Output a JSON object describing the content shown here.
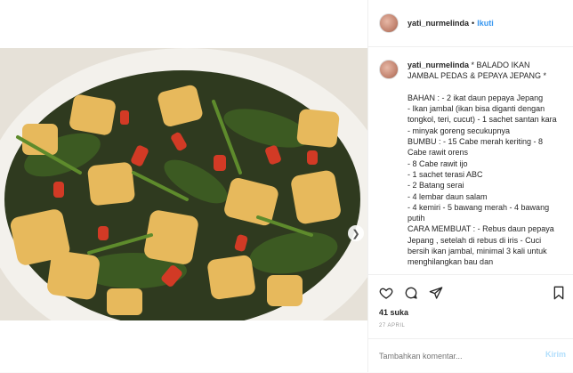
{
  "header": {
    "username": "yati_nurmelinda",
    "separator": "•",
    "follow_label": "Ikuti"
  },
  "caption": {
    "username": "yati_nurmelinda",
    "text": " * BALADO IKAN JAMBAL PEDAS & PEPAYA JEPANG *\n\nBAHAN : - 2 ikat daun pepaya Jepang\n- Ikan jambal (ikan bisa diganti dengan tongkol, teri, cucut) - 1 sachet santan kara\n- minyak goreng secukupnya\nBUMBU : - 15 Cabe merah keriting - 8 Cabe rawit orens\n- 8 Cabe rawit ijo\n- 1 sachet terasi ABC\n- 2 Batang serai\n- 4 lembar daun salam\n- 4 kemiri - 5 bawang merah - 4 bawang putih\nCARA MEMBUAT : - Rebus daun pepaya Jepang , setelah di rebus di iris - Cuci bersih ikan jambal, minimal 3 kali untuk menghilangkan bau dan"
  },
  "actions": {
    "likes": "41 suka",
    "date": "27 APRIL"
  },
  "comment": {
    "placeholder": "Tambahkan komentar...",
    "post_label": "Kirim"
  },
  "icons": {
    "like": "heart-icon",
    "comment": "comment-icon",
    "share": "share-icon",
    "save": "bookmark-icon",
    "next": "chevron-right-icon"
  },
  "colors": {
    "follow": "#3897f0",
    "post_disabled": "#b2dffc"
  }
}
